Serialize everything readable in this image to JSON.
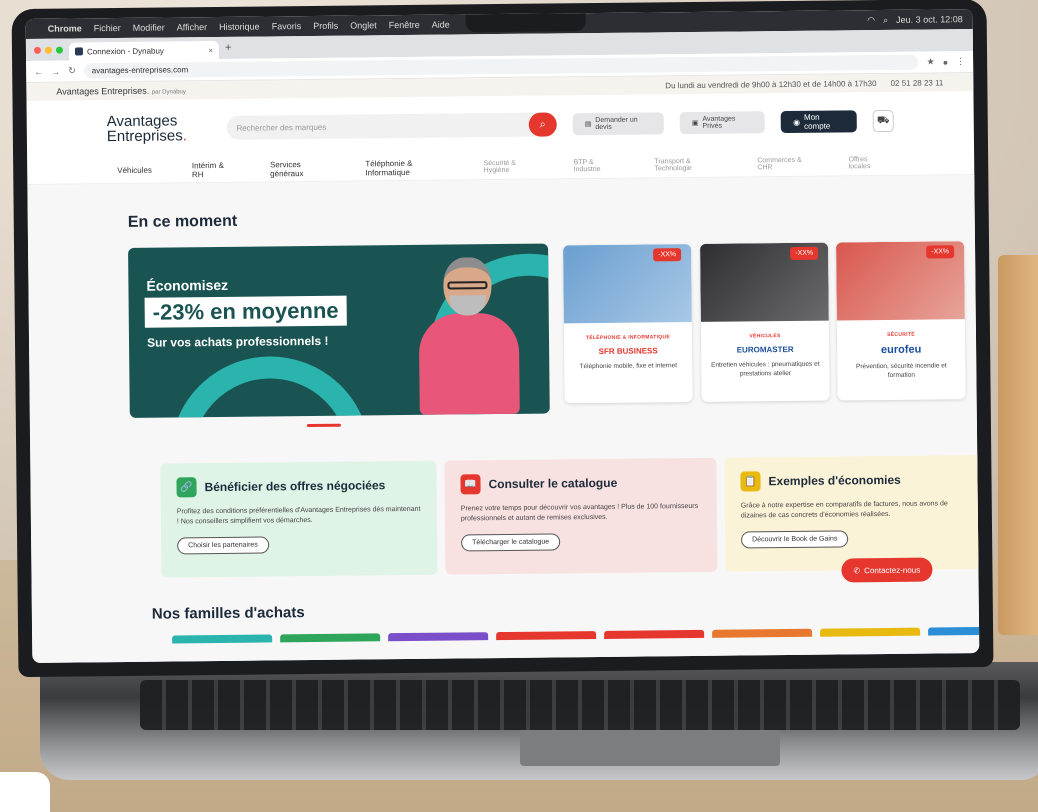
{
  "menubar": {
    "items": [
      "Chrome",
      "Fichier",
      "Modifier",
      "Afficher",
      "Historique",
      "Favoris",
      "Profils",
      "Onglet",
      "Fenêtre",
      "Aide"
    ],
    "datetime": "Jeu. 3 oct. 12:08"
  },
  "browser": {
    "tab_title": "Connexion - Dynabuy",
    "url": "avantages-entreprises.com"
  },
  "site": {
    "strip_brand": "Avantages Entreprises",
    "strip_by": "par Dynabuy",
    "hours": "Du lundi au vendredi de 9h00 à 12h30 et de 14h00 à 17h30",
    "phone": "02 51 28 23 11",
    "logo_line1": "Avantages",
    "logo_line2": "Entreprises",
    "search_placeholder": "Rechercher des marques",
    "btn_quote": "Demander un devis",
    "btn_offers": "Avantages Privés",
    "btn_account": "Mon compte",
    "nav": [
      "Véhicules",
      "Intérim & RH",
      "Services généraux",
      "Téléphonie & Informatique",
      "Sécurité & Hygiène",
      "BTP & Industrie",
      "Transport & Technologie",
      "Commerces & CHR",
      "Offres locales"
    ]
  },
  "main": {
    "section_title": "En ce moment",
    "hero": {
      "line1": "Économisez",
      "line2": "-23% en moyenne",
      "line3": "Sur vos achats professionnels !"
    },
    "cards": [
      {
        "badge": "-XX%",
        "category": "TÉLÉPHONIE & INFORMATIQUE",
        "logo": "SFR BUSINESS",
        "desc": "Téléphonie mobile, fixe et internet",
        "color": "#5a8fc4"
      },
      {
        "badge": "-XX%",
        "category": "VÉHICULES",
        "logo": "EUROMASTER",
        "desc": "Entretien véhicules : pneumatiques et prestations atelier",
        "color": "#3a3a3a"
      },
      {
        "badge": "-XX%",
        "category": "SÉCURITÉ",
        "logo": "eurofeu",
        "desc": "Prévention, sécurité incendie et formation",
        "color": "#c0504b"
      }
    ],
    "benefits": [
      {
        "title": "Bénéficier des offres négociées",
        "text": "Profitez des conditions préférentielles d'Avantages Entreprises dès maintenant ! Nos conseillers simplifient vos démarches.",
        "button": "Choisir les partenaires",
        "bg": "#dff3e6",
        "icon_bg": "#2fa55b",
        "icon": "🔗"
      },
      {
        "title": "Consulter le catalogue",
        "text": "Prenez votre temps pour découvrir vos avantages ! Plus de 100 fournisseurs professionnels et autant de remises exclusives.",
        "button": "Télécharger le catalogue",
        "bg": "#f8e1e1",
        "icon_bg": "#e6372f",
        "icon": "📖"
      },
      {
        "title": "Exemples d'économies",
        "text": "Grâce à notre expertise en comparatifs de factures, nous avons de dizaines de cas concrets d'économies réalisées.",
        "button": "Découvrir le Book de Gains",
        "bg": "#fbf3d7",
        "icon_bg": "#e8b90f",
        "icon": "📋"
      }
    ],
    "contact": "Contactez-nous",
    "families_title": "Nos familles d'achats",
    "family_colors": [
      "#2bb3ad",
      "#2fa55b",
      "#7b4fc9",
      "#e6372f",
      "#e6372f",
      "#e8782f",
      "#e8b90f",
      "#2b8fd8",
      "#1c2a3a"
    ]
  }
}
